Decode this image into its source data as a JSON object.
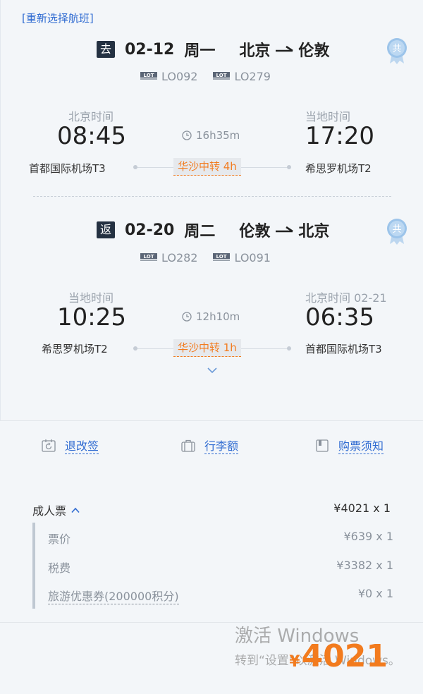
{
  "reselect_label": "[重新选择航班]",
  "legs": [
    {
      "badge": "去",
      "date": "02-12",
      "weekday": "周一",
      "origin_city": "北京",
      "dest_city": "伦敦",
      "flights": [
        "LO092",
        "LO279"
      ],
      "dep_tz": "北京时间",
      "dep_time": "08:45",
      "dep_airport": "首都国际机场T3",
      "duration": "16h35m",
      "transfer": "华沙中转 4h",
      "arr_tz": "当地时间",
      "arr_time": "17:20",
      "arr_airport": "希思罗机场T2"
    },
    {
      "badge": "返",
      "date": "02-20",
      "weekday": "周二",
      "origin_city": "伦敦",
      "dest_city": "北京",
      "flights": [
        "LO282",
        "LO091"
      ],
      "dep_tz": "当地时间",
      "dep_time": "10:25",
      "dep_airport": "希思罗机场T2",
      "duration": "12h10m",
      "transfer": "华沙中转 1h",
      "arr_tz": "北京时间  02-21",
      "arr_time": "06:35",
      "arr_airport": "首都国际机场T3"
    }
  ],
  "links": {
    "refund": "退改签",
    "baggage": "行李额",
    "notice": "购票须知"
  },
  "price": {
    "adult_label": "成人票",
    "adult_value": "¥4021 x 1",
    "rows": [
      {
        "label": "票价",
        "value": "¥639 x 1"
      },
      {
        "label": "税费",
        "value": "¥3382 x 1"
      },
      {
        "label": "旅游优惠券(200000积分)",
        "value": "¥0 x 1"
      }
    ],
    "total_currency": "¥",
    "total_amount": "4021"
  },
  "watermark": {
    "line1": "激活 Windows",
    "line2": "转到“设置”以激活 Windows。"
  },
  "colors": {
    "accent_blue": "#2f6bd1",
    "accent_orange": "#f27b1e",
    "badge_dark": "#243142"
  }
}
